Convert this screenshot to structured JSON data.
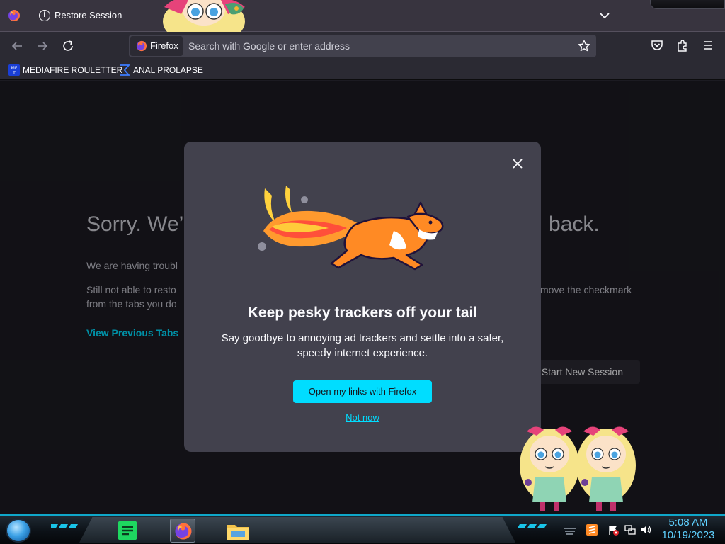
{
  "window": {
    "tab_title": "Restore Session"
  },
  "toolbar": {
    "identity_label": "Firefox",
    "url_placeholder": "Search with Google or enter address"
  },
  "bookmarks": [
    {
      "label": "MEDIAFIRE ROULETTER",
      "icon": "mediafire-icon"
    },
    {
      "label": "ANAL PROLAPSE",
      "icon": "sigma-icon"
    }
  ],
  "page": {
    "title_left": "Sorry. We’",
    "title_right": "back.",
    "para1_left": "We are having troubl",
    "para2_left_line1": "Still not able to resto",
    "para2_left_line2": "from the tabs you do",
    "para2_right": "move the checkmark",
    "view_tabs_link": "View Previous Tabs",
    "start_new_session": "Start New Session"
  },
  "modal": {
    "title": "Keep pesky trackers off your tail",
    "body": "Say goodbye to annoying ad trackers and settle into a safer, speedy internet experience.",
    "primary_button": "Open my links with Firefox",
    "secondary_link": "Not now"
  },
  "taskbar": {
    "clock_time": "5:08 AM",
    "clock_date": "10/19/2023"
  },
  "colors": {
    "accent": "#00ddff",
    "toolbar_bg": "#2b2a33",
    "tabbar_bg": "#38343f",
    "modal_bg": "#42414d",
    "page_bg": "#1c1b22",
    "clock": "#5fd1ff"
  }
}
